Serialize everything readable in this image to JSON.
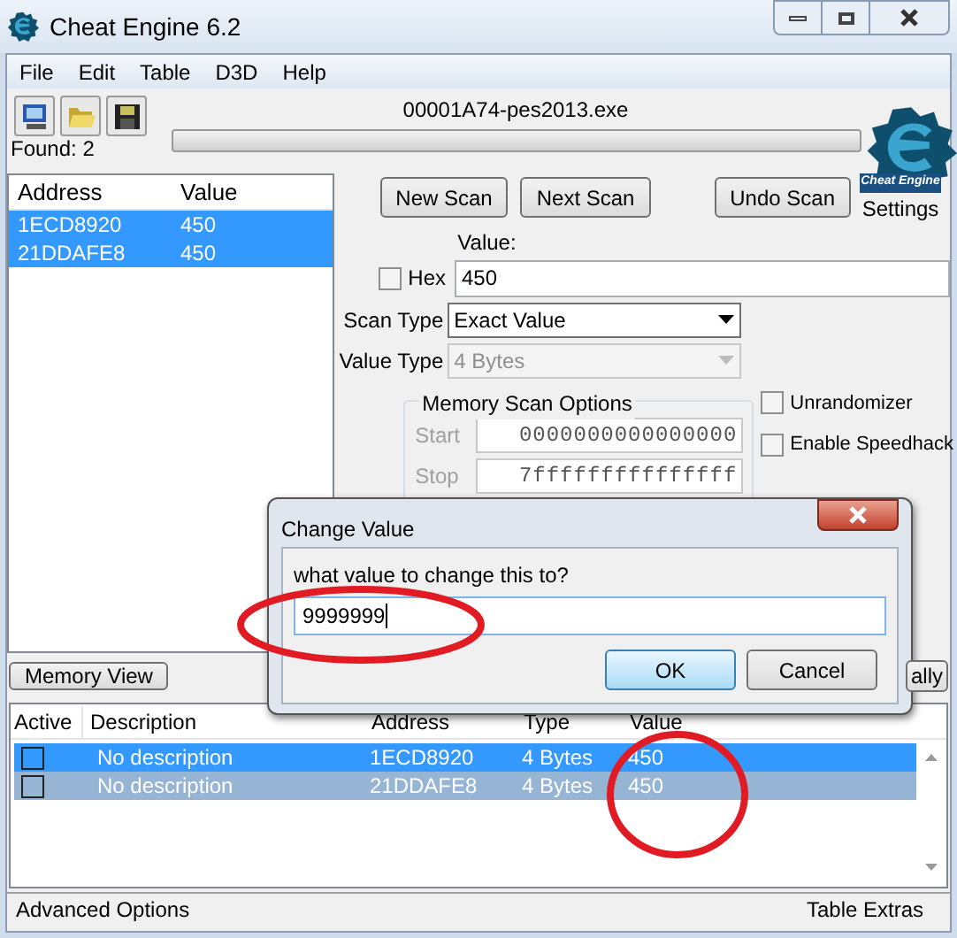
{
  "window": {
    "title": "Cheat Engine 6.2"
  },
  "menu": [
    "File",
    "Edit",
    "Table",
    "D3D",
    "Help"
  ],
  "process": "00001A74-pes2013.exe",
  "progress": {
    "level": 0
  },
  "found": "Found: 2",
  "results": {
    "columns": [
      "Address",
      "Value"
    ],
    "rows": [
      {
        "address": "1ECD8920",
        "value": "450",
        "selected": true
      },
      {
        "address": "21DDAFE8",
        "value": "450",
        "selected": true
      }
    ]
  },
  "scan_buttons": [
    "New Scan",
    "Next Scan",
    "Undo Scan"
  ],
  "settings": {
    "logo_text": "Cheat Engine",
    "label": "Settings"
  },
  "value": {
    "label": "Value:",
    "hex": {
      "label": "Hex",
      "checked": false
    },
    "value": "450"
  },
  "scan_type": {
    "label": "Scan Type",
    "value": "Exact Value",
    "disabled": false
  },
  "value_type": {
    "label": "Value Type",
    "value": "4 Bytes",
    "disabled": true
  },
  "memory_scan_options": {
    "title": "Memory Scan Options",
    "start": {
      "label": "Start",
      "value": "0000000000000000"
    },
    "stop": {
      "label": "Stop",
      "value": "7fffffffffffffff"
    }
  },
  "options": [
    {
      "label": "Unrandomizer",
      "checked": false
    },
    {
      "label": "Enable Speedhack",
      "checked": false
    }
  ],
  "memory_view_button": "Memory View",
  "add_address_button": "ally",
  "address_table": {
    "columns": [
      "Active",
      "Description",
      "Address",
      "Type",
      "Value"
    ],
    "rows": [
      {
        "active": false,
        "description": "No description",
        "address": "1ECD8920",
        "type": "4 Bytes",
        "value": "450",
        "selected": true,
        "focused": true
      },
      {
        "active": false,
        "description": "No description",
        "address": "21DDAFE8",
        "type": "4 Bytes",
        "value": "450",
        "selected": true,
        "focused": false
      }
    ]
  },
  "status_bar": {
    "left": "Advanced Options",
    "right": "Table Extras"
  },
  "dialog": {
    "title": "Change Value",
    "prompt": "what value to change this to?",
    "value": "9999999",
    "buttons": [
      {
        "label": "OK",
        "default": true
      },
      {
        "label": "Cancel",
        "default": false
      }
    ]
  }
}
